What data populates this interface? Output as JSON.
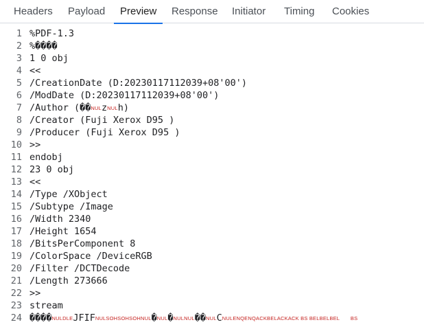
{
  "tabs": [
    "Headers",
    "Payload",
    "Preview",
    "Response",
    "Initiator",
    "Timing",
    "Cookies"
  ],
  "active_tab": "Preview",
  "colors": {
    "accent": "#1a73e8",
    "control_char": "#c5221f",
    "line_number": "#5f6368"
  },
  "lines": [
    {
      "n": "1",
      "segs": [
        {
          "t": "%PDF-1.3"
        }
      ]
    },
    {
      "n": "2",
      "segs": [
        {
          "t": "%����"
        }
      ]
    },
    {
      "n": "3",
      "segs": [
        {
          "t": "1 0 obj"
        }
      ]
    },
    {
      "n": "4",
      "segs": [
        {
          "t": "<<"
        }
      ]
    },
    {
      "n": "5",
      "segs": [
        {
          "t": "/CreationDate (D:20230117112039+08'00')"
        }
      ]
    },
    {
      "n": "6",
      "segs": [
        {
          "t": "/ModDate (D:20230117112039+08'00')"
        }
      ]
    },
    {
      "n": "7",
      "segs": [
        {
          "t": "/Author (��"
        },
        {
          "t": "NUL",
          "c": 1
        },
        {
          "t": "z"
        },
        {
          "t": "NUL",
          "c": 1
        },
        {
          "t": "h)"
        }
      ]
    },
    {
      "n": "8",
      "segs": [
        {
          "t": "/Creator (Fuji Xerox D95 )"
        }
      ]
    },
    {
      "n": "9",
      "segs": [
        {
          "t": "/Producer (Fuji Xerox D95 )"
        }
      ]
    },
    {
      "n": "10",
      "segs": [
        {
          "t": ">>"
        }
      ]
    },
    {
      "n": "11",
      "segs": [
        {
          "t": "endobj"
        }
      ]
    },
    {
      "n": "12",
      "segs": [
        {
          "t": "23 0 obj"
        }
      ]
    },
    {
      "n": "13",
      "segs": [
        {
          "t": "<<"
        }
      ]
    },
    {
      "n": "14",
      "segs": [
        {
          "t": "/Type /XObject"
        }
      ]
    },
    {
      "n": "15",
      "segs": [
        {
          "t": "/Subtype /Image"
        }
      ]
    },
    {
      "n": "16",
      "segs": [
        {
          "t": "/Width 2340"
        }
      ]
    },
    {
      "n": "17",
      "segs": [
        {
          "t": "/Height 1654"
        }
      ]
    },
    {
      "n": "18",
      "segs": [
        {
          "t": "/BitsPerComponent 8"
        }
      ]
    },
    {
      "n": "19",
      "segs": [
        {
          "t": "/ColorSpace /DeviceRGB"
        }
      ]
    },
    {
      "n": "20",
      "segs": [
        {
          "t": "/Filter /DCTDecode"
        }
      ]
    },
    {
      "n": "21",
      "segs": [
        {
          "t": "/Length 273666"
        }
      ]
    },
    {
      "n": "22",
      "segs": [
        {
          "t": ">>"
        }
      ]
    },
    {
      "n": "23",
      "segs": [
        {
          "t": "stream"
        }
      ]
    },
    {
      "n": "24",
      "segs": [
        {
          "t": "����"
        },
        {
          "t": "NULDLE",
          "c": 1
        },
        {
          "t": "JFIF"
        },
        {
          "t": "NULSOHSOHSOHNUL",
          "c": 1
        },
        {
          "t": "�"
        },
        {
          "t": "NUL",
          "c": 1
        },
        {
          "t": "�"
        },
        {
          "t": "NULNUL",
          "c": 1
        },
        {
          "t": "��"
        },
        {
          "t": "NUL",
          "c": 1
        },
        {
          "t": "C"
        },
        {
          "t": "NULENQENQACKBELACKACK BS BELBELBEL       BS",
          "c": 1
        }
      ]
    }
  ]
}
